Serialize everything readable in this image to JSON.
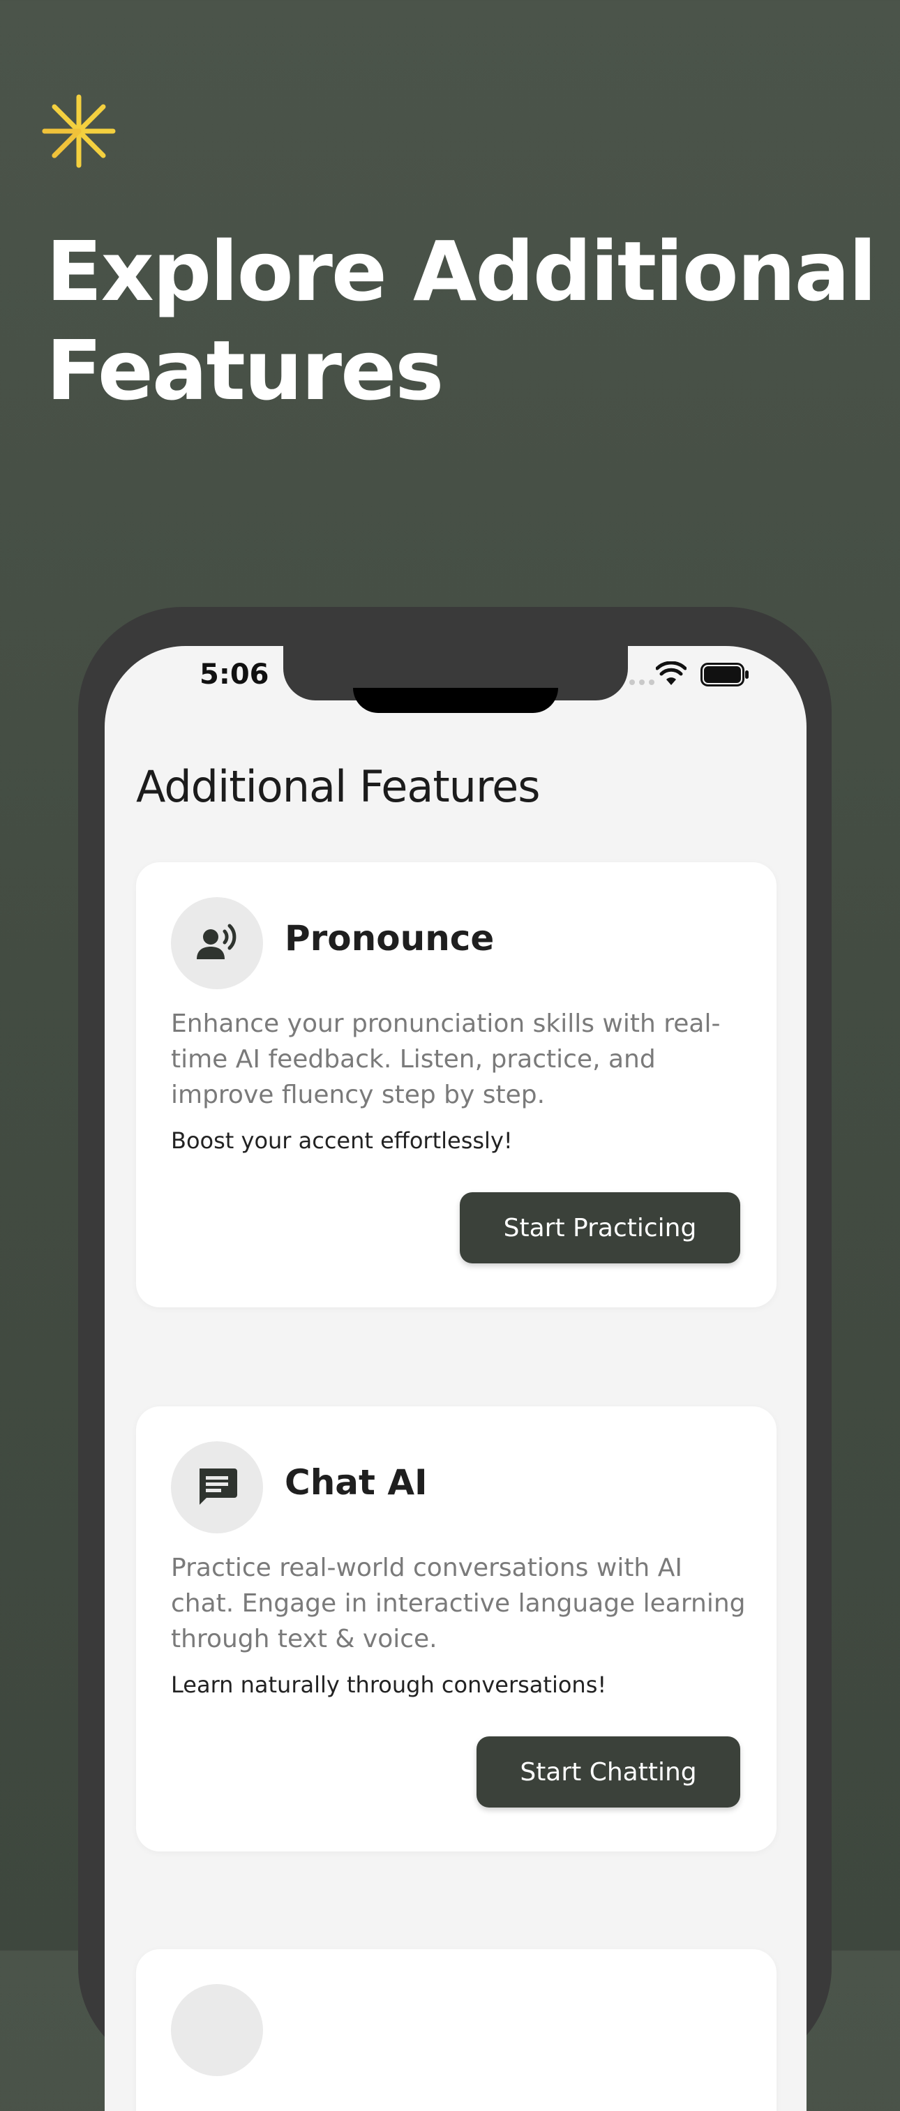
{
  "hero": {
    "icon": "sparkle-icon",
    "accent_color": "#f4d03f",
    "headline": "Explore Additional Features"
  },
  "status_bar": {
    "time": "5:06",
    "icons": [
      "wifi-icon",
      "battery-icon"
    ]
  },
  "screen": {
    "title": "Additional Features"
  },
  "cards": [
    {
      "icon": "voice-person-icon",
      "title": "Pronounce",
      "description": "Enhance your pronunciation skills with real-time AI feedback. Listen, practice, and improve fluency step by step.",
      "tagline": "Boost your accent effortlessly!",
      "button_label": "Start Practicing"
    },
    {
      "icon": "chat-message-icon",
      "title": "Chat AI",
      "description": "Practice real-world conversations with AI chat. Engage in interactive language learning through text & voice.",
      "tagline": "Learn naturally through conversations!",
      "button_label": "Start Chatting"
    }
  ],
  "colors": {
    "background": "#474f45",
    "button": "#3b413a",
    "card": "#ffffff",
    "screen_background": "#f4f4f4"
  }
}
